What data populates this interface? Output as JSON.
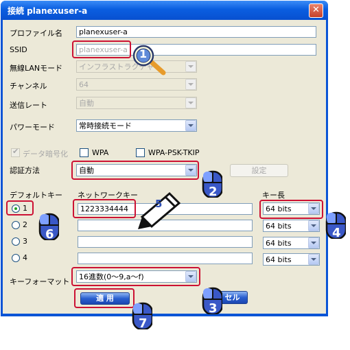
{
  "window": {
    "title": "接続 planexuser-a",
    "close_glyph": "✕"
  },
  "form": {
    "profile_label": "プロファイル名",
    "profile_value": "planexuser-a",
    "ssid_label": "SSID",
    "ssid_value": "planexuser-a",
    "lan_mode_label": "無線LANモード",
    "lan_mode_value": "インフラストラクチャ",
    "channel_label": "チャンネル",
    "channel_value": "64",
    "tx_rate_label": "送信レート",
    "tx_rate_value": "自動",
    "power_mode_label": "パワーモード",
    "power_mode_value": "常時接続モード",
    "encryption_label": "データ暗号化",
    "wpa_label": "WPA",
    "wpa_psk_label": "WPA-PSK-TKIP",
    "auth_label": "認証方法",
    "auth_value": "自動",
    "settings_button": "設定",
    "default_key_header": "デフォルトキー",
    "network_key_header": "ネットワークキー",
    "key_length_header": "キー長",
    "keys": [
      {
        "index": "1",
        "value": "1223334444",
        "length": "64 bits",
        "selected": true
      },
      {
        "index": "2",
        "value": "",
        "length": "64 bits",
        "selected": false
      },
      {
        "index": "3",
        "value": "",
        "length": "64 bits",
        "selected": false
      },
      {
        "index": "4",
        "value": "",
        "length": "64 bits",
        "selected": false
      }
    ],
    "key_format_label": "キーフォーマット",
    "key_format_value": "16進数(0～9,a～f)",
    "apply_button": "適 用",
    "cancel_button": "キャンセル",
    "cancel_button_visible": "セル"
  },
  "annotations": {
    "step1": "1",
    "step2": "2",
    "step3": "3",
    "step4": "4",
    "step5": "5",
    "step6": "6",
    "step7": "7"
  },
  "colors": {
    "highlight": "#cc1133",
    "titlebar": "#0a54d6",
    "dialog_bg": "#ece9d8"
  }
}
